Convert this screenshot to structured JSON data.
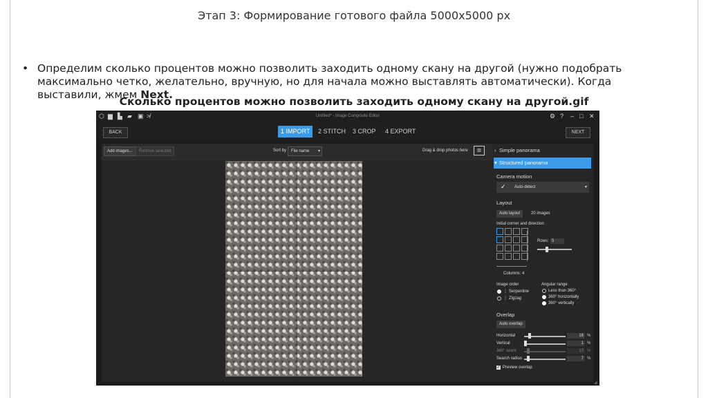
{
  "slide": {
    "title": "Этап 3: Формирование готового файла 5000х5000 px",
    "bullet_text": "Определим сколько процентов можно позволить заходить одному скану на другой (нужно подобрать максимально четко, желательно, вручную, но для начала можно выставлять автоматически). Когда выставили, жмем ",
    "bullet_bold": "Next.",
    "gif_title": "Сколько процентов можно позволить заходить одному скану на другой.gif"
  },
  "app": {
    "window_title": "Untitled* - Image Composite Editor",
    "nav": {
      "back_label": "BACK",
      "next_label": "NEXT",
      "steps": [
        {
          "num": "1",
          "label": "IMPORT",
          "active": true
        },
        {
          "num": "2",
          "label": "STITCH",
          "active": false
        },
        {
          "num": "3",
          "label": "CROP",
          "active": false
        },
        {
          "num": "4",
          "label": "EXPORT",
          "active": false
        }
      ]
    },
    "toolbar": {
      "add_images": "Add images...",
      "remove_selected": "Remove selected",
      "sort_by_label": "Sort by",
      "sort_by_value": "File name",
      "drag_drop": "Drag & drop photos here"
    },
    "panel": {
      "simple_panorama": "Simple panorama",
      "structured_panorama": "Structured panorama",
      "camera_motion_label": "Camera motion",
      "camera_motion_value": "Auto-detect",
      "layout_label": "Layout",
      "auto_layout": "Auto layout",
      "images_count": "20 images",
      "initial_corner": "Initial corner and direction",
      "rows_label": "Rows:",
      "rows_value": "5",
      "columns_label": "Columns: 4",
      "image_order_label": "Image order",
      "serpentine": "Serpentine",
      "zigzag": "Zigzag",
      "angular_range_label": "Angular range",
      "less_than_360": "Less than 360°",
      "horiz_360": "360° horizontally",
      "vert_360": "360° vertically",
      "overlap_label": "Overlap",
      "auto_overlap": "Auto overlap",
      "horizontal_label": "Horizontal",
      "horizontal_value": "16",
      "vertical_label": "Vertical",
      "vertical_value": "1",
      "seam_label": "360° seam",
      "seam_value": "10",
      "search_radius_label": "Search radius",
      "search_radius_value": "7",
      "percent": "%",
      "preview_overlap": "Preview overlap"
    },
    "colors": {
      "accent": "#3c9be8",
      "window_bg": "#1c1c1c",
      "panel_bg": "#262626"
    }
  }
}
